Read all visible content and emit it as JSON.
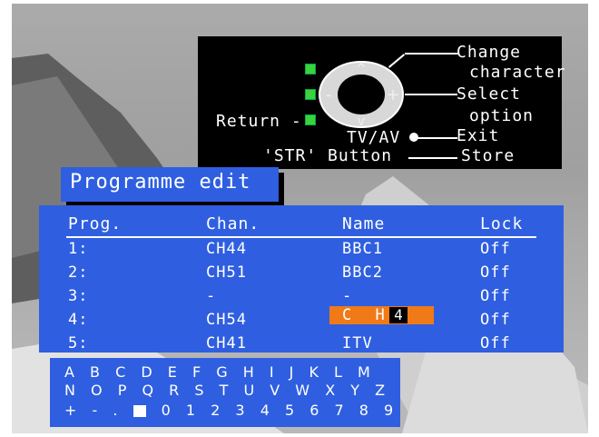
{
  "help": {
    "change_line1": "Change",
    "change_line2": "character",
    "select_line1": "Select",
    "select_line2": "option",
    "return_label": "Return -",
    "tvav_label": "TV/AV",
    "exit_label": "Exit",
    "str_label": "'STR' Button",
    "store_label": "Store"
  },
  "title": "Programme edit",
  "table": {
    "headers": [
      "Prog.",
      "Chan.",
      "Name",
      "Lock"
    ],
    "rows": [
      {
        "prog": "1:",
        "chan": "CH44",
        "name": "BBC1",
        "lock": "Off"
      },
      {
        "prog": "2:",
        "chan": "CH51",
        "name": "BBC2",
        "lock": "Off"
      },
      {
        "prog": "3:",
        "chan": "-",
        "name": "-",
        "lock": "Off"
      },
      {
        "prog": "4:",
        "chan": "CH54",
        "name": "C H",
        "cursor": "4",
        "lock": "Off"
      },
      {
        "prog": "5:",
        "chan": "CH41",
        "name": "ITV",
        "lock": "Off"
      }
    ]
  },
  "chars": {
    "row1": "A B C D E F G H I J K L M",
    "row2": "N O P Q R S T U V W X Y Z",
    "row3_pre": "+ - .",
    "row3_post": "0 1 2 3 4 5 6 7 8 9"
  },
  "colors": {
    "panel_blue": "#2f5fe0",
    "highlight_orange": "#f07a18",
    "indicator_green": "#3ad33a"
  }
}
